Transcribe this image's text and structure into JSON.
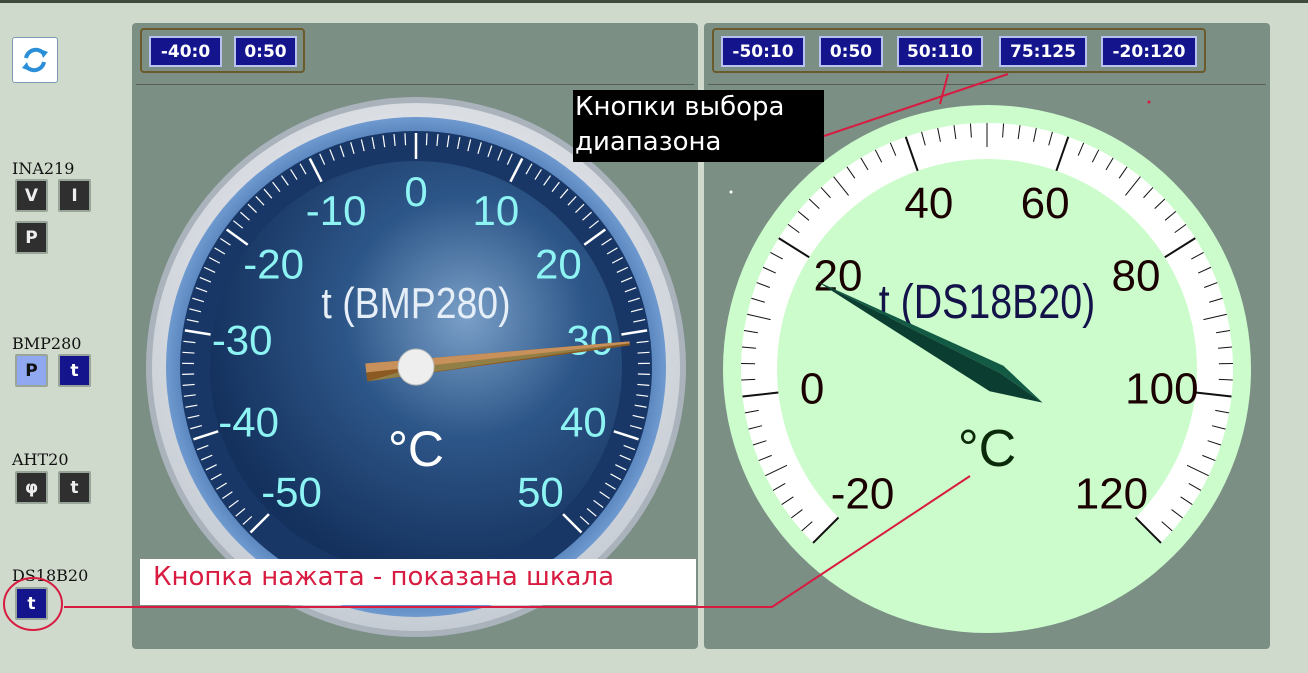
{
  "sidebar": {
    "refresh_icon": "refresh-icon",
    "groups": [
      {
        "label": "INA219",
        "buttons": [
          "V",
          "I",
          "P"
        ]
      },
      {
        "label": "BMP280",
        "buttons": [
          "P",
          "t"
        ]
      },
      {
        "label": "AHT20",
        "buttons": [
          "φ",
          "t"
        ]
      },
      {
        "label": "DS18B20",
        "buttons": [
          "t"
        ]
      }
    ]
  },
  "panel_left": {
    "ranges": [
      "-40:0",
      "0:50"
    ],
    "gauge": {
      "title": "t (BMP280)",
      "unit": "°C",
      "scale_labels": [
        "-50",
        "-40",
        "-30",
        "-20",
        "-10",
        "0",
        "10",
        "20",
        "30",
        "40",
        "50"
      ],
      "min": -50,
      "max": 50,
      "value": 31,
      "colors": {
        "face": "#1b3d6e",
        "labels": "#8df3f3",
        "rim": "#4d7ab0"
      }
    }
  },
  "panel_right": {
    "ranges": [
      "-50:10",
      "0:50",
      "50:110",
      "75:125",
      "-20:120"
    ],
    "gauge": {
      "title": "t (DS18B20)",
      "unit": "°C",
      "scale_labels": [
        "-20",
        "0",
        "20",
        "40",
        "60",
        "80",
        "100",
        "120"
      ],
      "min": -20,
      "max": 120,
      "value": 18,
      "colors": {
        "face": "#ccfccc",
        "labels": "#1a0000",
        "needle": "#0e4a3a"
      }
    }
  },
  "annotations": {
    "range_buttons_note": [
      "Кнопки выбора",
      "диапазона"
    ],
    "pressed_note": "Кнопка нажата - показана шкала",
    "color": "#d81b40"
  }
}
